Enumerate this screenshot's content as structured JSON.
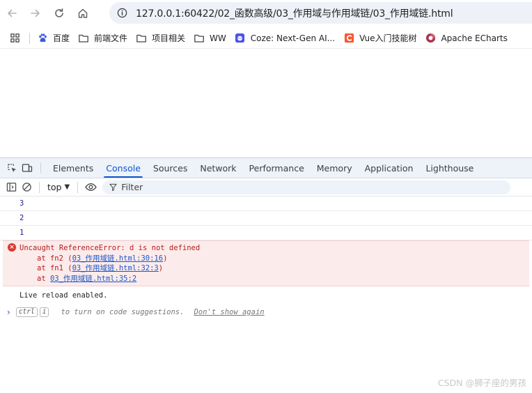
{
  "browser": {
    "url": "127.0.0.1:60422/02_函数高级/03_作用域与作用域链/03_作用域链.html"
  },
  "bookmarks": [
    {
      "label": "百度",
      "icon": "baidu-icon"
    },
    {
      "label": "前端文件",
      "icon": "folder-icon"
    },
    {
      "label": "项目相关",
      "icon": "folder-icon"
    },
    {
      "label": "WW",
      "icon": "folder-icon"
    },
    {
      "label": "Coze: Next-Gen AI...",
      "icon": "coze-icon"
    },
    {
      "label": "Vue入门技能树",
      "icon": "csdn-icon"
    },
    {
      "label": "Apache ECharts",
      "icon": "echarts-icon"
    }
  ],
  "devtools": {
    "tabs": [
      "Elements",
      "Console",
      "Sources",
      "Network",
      "Performance",
      "Memory",
      "Application",
      "Lighthouse"
    ],
    "active_tab": "Console",
    "context": "top",
    "filter_placeholder": "Filter"
  },
  "console": {
    "logs": [
      "3",
      "2",
      "1"
    ],
    "error": {
      "message": "Uncaught ReferenceError: d is not defined",
      "stack": [
        {
          "prefix": "at fn2 (",
          "link": "03_作用域链.html:30:16",
          "suffix": ")"
        },
        {
          "prefix": "at fn1 (",
          "link": "03_作用域链.html:32:3",
          "suffix": ")"
        },
        {
          "prefix": "at ",
          "link": "03_作用域链.html:35:2",
          "suffix": ""
        }
      ]
    },
    "info": "Live reload enabled.",
    "prompt": {
      "key1": "ctrl",
      "key2": "i",
      "hint": "to turn on code suggestions.",
      "dismiss": "Don't show again"
    }
  },
  "watermark": "CSDN @狮子座的男孩",
  "colors": {
    "accent": "#0b57d0",
    "error_bg": "#fcebeb",
    "error_text": "#b81a1a",
    "log_text": "#1a1aa6"
  }
}
